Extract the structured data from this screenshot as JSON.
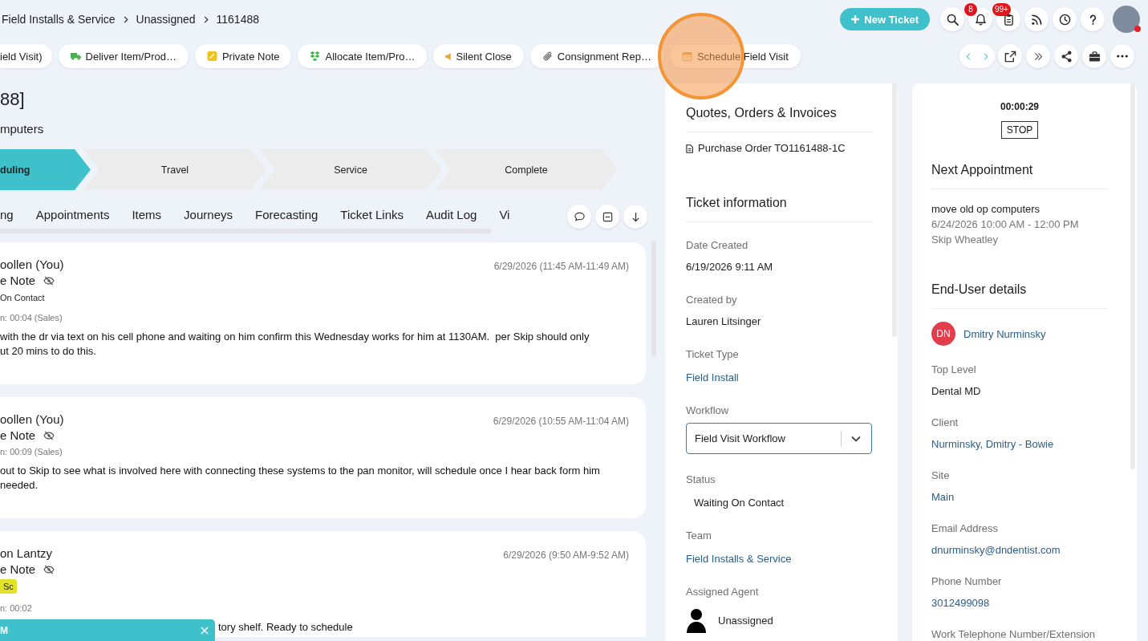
{
  "breadcrumb": [
    "Field Installs & Service",
    "Unassigned",
    "1161488"
  ],
  "new_ticket": {
    "label": "New Ticket"
  },
  "header_badges": {
    "notifications": "8",
    "tasks": "99+"
  },
  "actions": [
    {
      "label": "ield Visit)",
      "highlighted": false
    },
    {
      "label": "Deliver Item/Prod…",
      "highlighted": false
    },
    {
      "label": "Private Note",
      "highlighted": false
    },
    {
      "label": "Allocate Item/Pro…",
      "highlighted": false
    },
    {
      "label": "Silent Close",
      "highlighted": false
    },
    {
      "label": "Consignment Rep…",
      "highlighted": false
    },
    {
      "label": "Schedule Field Visit",
      "highlighted": true
    }
  ],
  "ticket": {
    "title": "88]",
    "subtitle": "mputers"
  },
  "stages": [
    {
      "label": "duling",
      "selected": true
    },
    {
      "label": "Travel",
      "selected": false
    },
    {
      "label": "Service",
      "selected": false
    },
    {
      "label": "Complete",
      "selected": false
    }
  ],
  "tabs": [
    {
      "label": "ng",
      "selected": false
    },
    {
      "label": "Appointments",
      "selected": false
    },
    {
      "label": "Items",
      "selected": false
    },
    {
      "label": "Journeys",
      "selected": false
    },
    {
      "label": "Forecasting",
      "selected": false
    },
    {
      "label": "Ticket Links",
      "selected": false
    },
    {
      "label": "Audit Log",
      "selected": false
    },
    {
      "label": "Vi",
      "selected": false
    }
  ],
  "notes": [
    {
      "author": "oollen (You)",
      "type": "e Note",
      "private": true,
      "status": "On Contact",
      "time_spent": "n: 00:04 (Sales)",
      "date": "6/29/2026 (11:45 AM-11:49 AM)",
      "body": "with the dr via text on his cell phone and waiting on him confirm this Wednesday works for him at 1130AM.  per Skip should only\nut 20 mins to do this."
    },
    {
      "author": "oollen (You)",
      "type": "e Note",
      "private": true,
      "time_spent": "n: 00:09 (Sales)",
      "date": "6/29/2026 (10:55 AM-11:04 AM)",
      "body": "out to Skip to see what is involved here with connecting these systems to the pan monitor, will schedule once I hear back form him\nneeded."
    },
    {
      "author": "on Lantzy",
      "type": "e Note",
      "private": true,
      "tag": "Sc",
      "time_spent": "n: 00:02",
      "date": "6/29/2026 (9:50 AM-9:52 AM)",
      "body": "tory shelf. Ready to schedule"
    }
  ],
  "chat_bar": {
    "label": "M"
  },
  "quotes": {
    "title": "Quotes, Orders & Invoices",
    "documents": [
      "Purchase Order TO1161488-1C"
    ]
  },
  "ticket_info": {
    "title": "Ticket information",
    "fields": [
      {
        "label": "Date Created",
        "kind": "text",
        "value": "6/19/2026 9:11 AM"
      },
      {
        "label": "Created by",
        "kind": "text",
        "value": "Lauren Litsinger"
      },
      {
        "label": "Ticket Type",
        "kind": "link",
        "value": "Field Install"
      },
      {
        "label": "Workflow",
        "kind": "select",
        "value": "Field Visit Workflow",
        "focused": true
      },
      {
        "label": "Status",
        "kind": "status",
        "value": "Waiting On Contact"
      },
      {
        "label": "Team",
        "kind": "link",
        "value": "Field Installs & Service"
      },
      {
        "label": "Assigned Agent",
        "kind": "agent",
        "value": "Unassigned"
      }
    ]
  },
  "timer": {
    "elapsed": "00:00:29",
    "button": "STOP"
  },
  "next_appointment": {
    "title": "Next Appointment",
    "subject": "move old op computers",
    "when": "6/24/2026 10:00 AM - 12:00 PM",
    "agent": "Skip Wheatley"
  },
  "end_user": {
    "title": "End-User details",
    "initials": "DN",
    "name": "Dmitry Nurminsky",
    "fields": [
      {
        "label": "Top Level",
        "kind": "text",
        "value": "Dental MD"
      },
      {
        "label": "Client",
        "kind": "link",
        "value": "Nurminsky, Dmitry - Bowie"
      },
      {
        "label": "Site",
        "kind": "link",
        "value": "Main"
      },
      {
        "label": "Email Address",
        "kind": "link",
        "value": "dnurminsky@dndentist.com"
      },
      {
        "label": "Phone Number",
        "kind": "link",
        "value": "3012499098"
      },
      {
        "label": "Work Telephone Number/Extension"
      }
    ]
  }
}
